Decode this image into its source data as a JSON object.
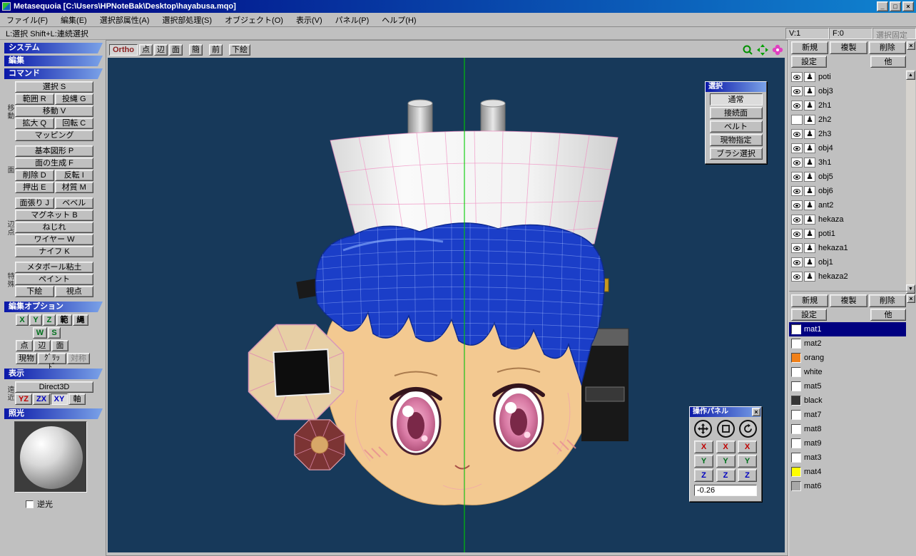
{
  "titlebar": {
    "title": "Metasequoia [C:\\Users\\HPNoteBak\\Desktop\\hayabusa.mqo]"
  },
  "glyphs": {
    "minimize": "_",
    "maximize": "□",
    "close": "×",
    "up": "▲",
    "down": "▼",
    "object_icon": "♟",
    "panel_close": "×"
  },
  "menubar": {
    "items": [
      "ファイル(F)",
      "編集(E)",
      "選択部属性(A)",
      "選択部処理(S)",
      "オブジェクト(O)",
      "表示(V)",
      "パネル(P)",
      "ヘルプ(H)"
    ]
  },
  "statusbar": {
    "hint": "L:選択  Shift+L:連続選択",
    "vertex_count": "V:1",
    "face_count": "F:0",
    "lock_label": "選択固定"
  },
  "sidebar": {
    "headers": {
      "system": "システム",
      "edit": "編集",
      "command": "コマンド",
      "edit_options": "編集オプション",
      "display": "表示",
      "lighting": "照光"
    },
    "group_labels": [
      "移動",
      "面",
      "辺点",
      "特殊"
    ],
    "commands": [
      "選択 S",
      "範囲 R",
      "投縄 G",
      "移動 V",
      "拡大 Q",
      "回転 C",
      "マッピング",
      "基本図形 P",
      "面の生成 F",
      "削除 D",
      "反転 I",
      "押出 E",
      "材質 M",
      "面張り J",
      "ベベル",
      "マグネット B",
      "ねじれ",
      "ワイヤー W",
      "ナイフ K",
      "メタボール粘土",
      "ペイント",
      "下絵",
      "視点"
    ],
    "edit_options": {
      "x": "X",
      "y": "Y",
      "z": "Z",
      "han": "範",
      "nawa": "縄",
      "w": "W",
      "s": "S",
      "point": "点",
      "edge": "辺",
      "face": "面",
      "genbutsu": "現物",
      "grid": "ｸﾞﾘｯﾄﾞ",
      "taishou": "対称"
    },
    "display": {
      "side_label": "遠近",
      "renderer": "Direct3D",
      "views": [
        "YZ",
        "ZX",
        "XY",
        "軸"
      ]
    },
    "lighting": {
      "backlight": "逆光"
    }
  },
  "viewport": {
    "mode_label": "Ortho",
    "buttons": [
      "点",
      "辺",
      "面",
      "簡",
      "前",
      "下絵"
    ]
  },
  "selection_panel": {
    "title": "選択",
    "options": [
      "通常",
      "接続面",
      "ベルト",
      "現物指定",
      "ブラシ選択"
    ]
  },
  "operation_panel": {
    "title": "操作パネル",
    "x": "X",
    "y": "Y",
    "z": "Z",
    "value": "-0.26"
  },
  "object_panel": {
    "new_label": "新規",
    "dup_label": "複製",
    "del_label": "削除",
    "settings_label": "設定",
    "other_label": "他",
    "objects": [
      {
        "name": "poti",
        "visible": true
      },
      {
        "name": "obj3",
        "visible": true
      },
      {
        "name": "2h1",
        "visible": true
      },
      {
        "name": "2h2",
        "visible": false
      },
      {
        "name": "2h3",
        "visible": true
      },
      {
        "name": "obj4",
        "visible": true
      },
      {
        "name": "3h1",
        "visible": true
      },
      {
        "name": "obj5",
        "visible": true
      },
      {
        "name": "obj6",
        "visible": true
      },
      {
        "name": "ant2",
        "visible": true
      },
      {
        "name": "hekaza",
        "visible": true
      },
      {
        "name": "poti1",
        "visible": true
      },
      {
        "name": "hekaza1",
        "visible": true
      },
      {
        "name": "obj1",
        "visible": true
      },
      {
        "name": "hekaza2",
        "visible": true
      }
    ]
  },
  "material_panel": {
    "new_label": "新規",
    "dup_label": "複製",
    "del_label": "削除",
    "settings_label": "設定",
    "other_label": "他",
    "materials": [
      {
        "name": "mat1",
        "color": "#ffffff",
        "selected": true
      },
      {
        "name": "mat2",
        "color": "#ffffff"
      },
      {
        "name": "orang",
        "color": "#f08018"
      },
      {
        "name": "white",
        "color": "#ffffff"
      },
      {
        "name": "mat5",
        "color": "#ffffff"
      },
      {
        "name": "black",
        "color": "#353535"
      },
      {
        "name": "mat7",
        "color": "#ffffff"
      },
      {
        "name": "mat8",
        "color": "#ffffff"
      },
      {
        "name": "mat9",
        "color": "#ffffff"
      },
      {
        "name": "mat3",
        "color": "#ffffff"
      },
      {
        "name": "mat4",
        "color": "#ffff00"
      },
      {
        "name": "mat6",
        "color": "#a8a8a8"
      }
    ]
  }
}
